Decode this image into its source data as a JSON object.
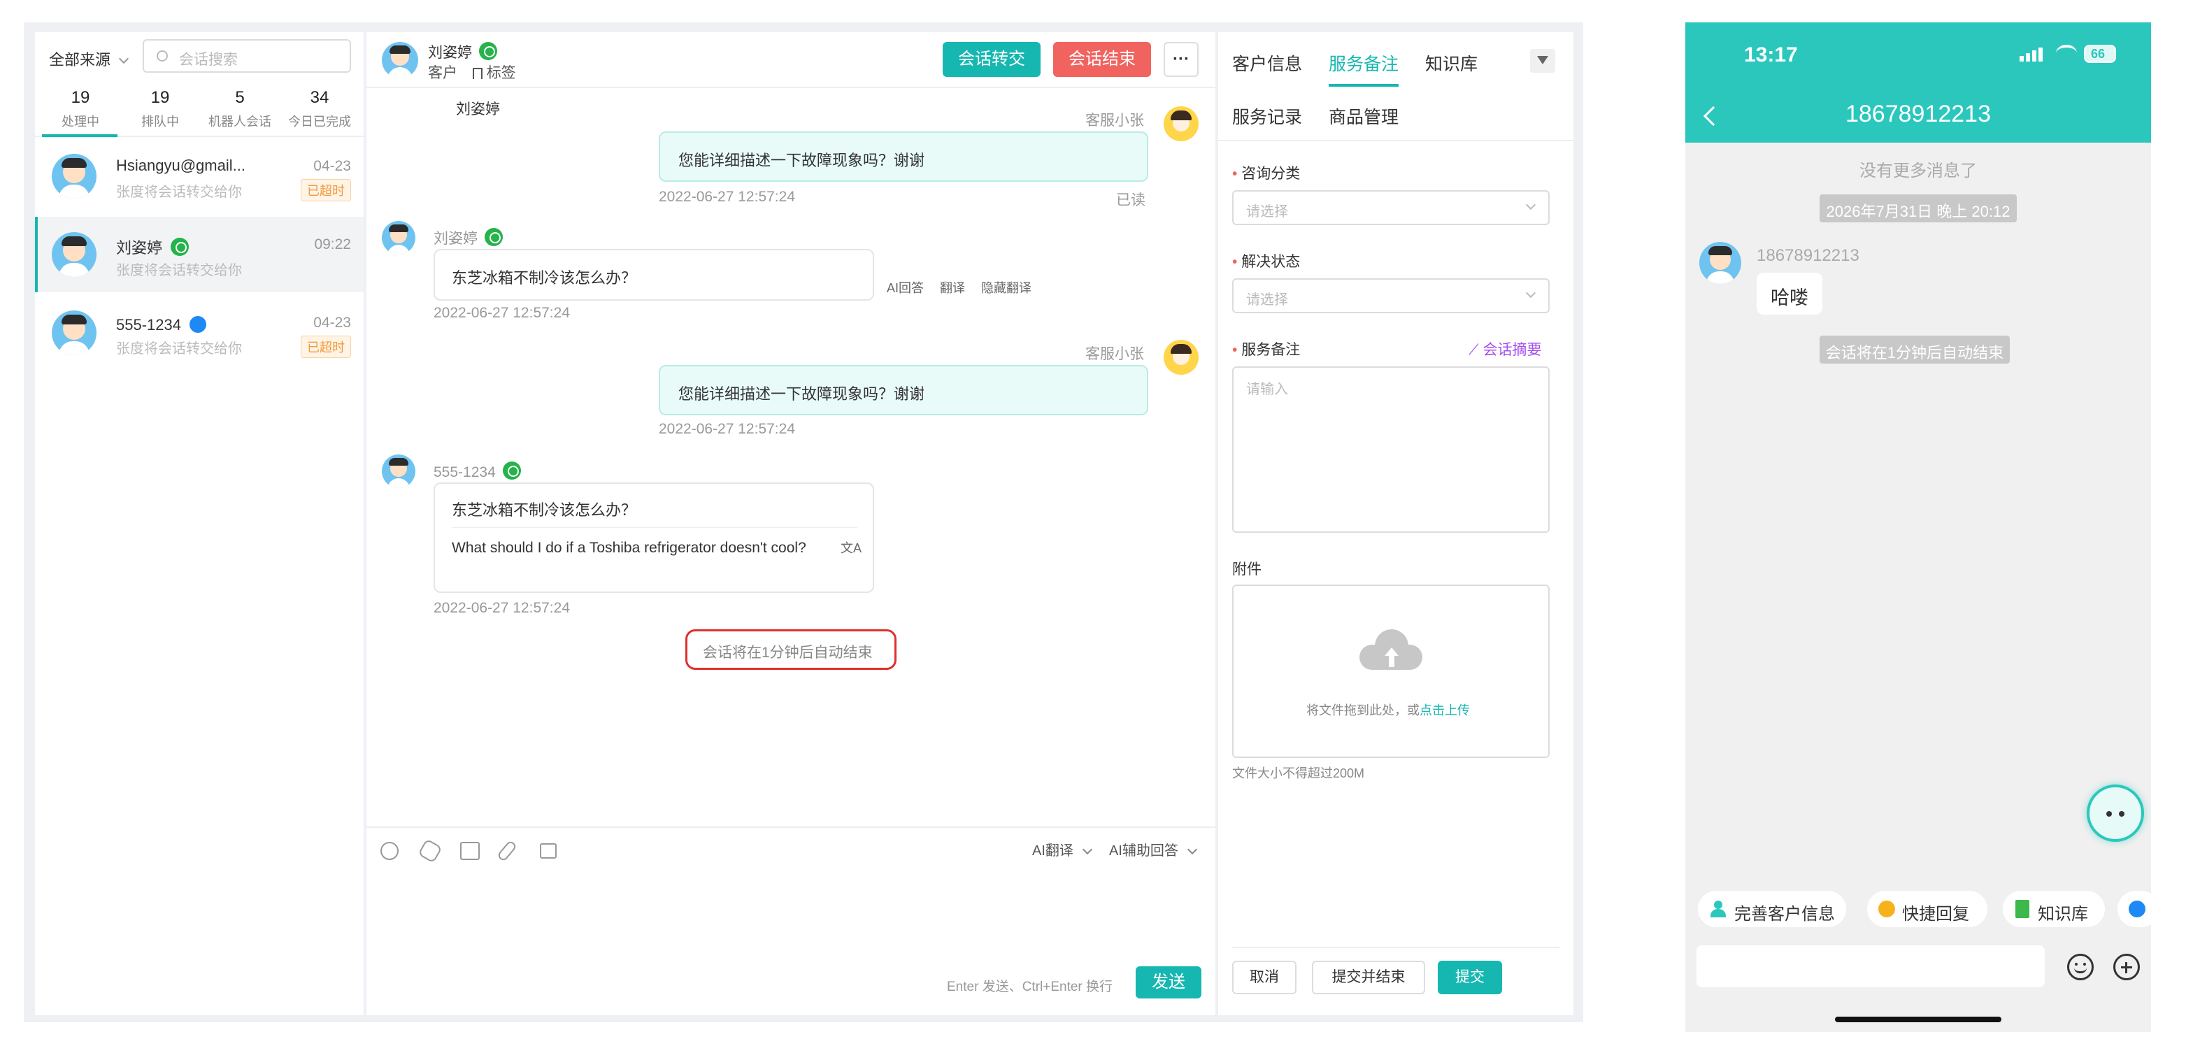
{
  "left": {
    "source_filter": "全部来源",
    "search_placeholder": "会话搜索",
    "stats": [
      {
        "num": "19",
        "label": "处理中"
      },
      {
        "num": "19",
        "label": "排队中"
      },
      {
        "num": "5",
        "label": "机器人会话"
      },
      {
        "num": "34",
        "label": "今日已完成"
      }
    ],
    "conversations": [
      {
        "name": "Hsiangyu@gmail...",
        "preview": "张度将会话转交给你",
        "time": "04-23",
        "badge": "已超时"
      },
      {
        "name": "刘姿婷",
        "preview": "张度将会话转交给你",
        "time": "09:22",
        "badge": ""
      },
      {
        "name": "555-1234",
        "preview": "张度将会话转交给你",
        "time": "04-23",
        "badge": "已超时"
      }
    ]
  },
  "header": {
    "name": "刘姿婷",
    "role": "客户",
    "tag_label": "标签",
    "transfer_button": "会话转交",
    "end_button": "会话结束",
    "more_button": "···"
  },
  "chat": {
    "top_name": "刘姿婷",
    "messages": [
      {
        "sender": "客服小张",
        "text": "您能详细描述一下故障现象吗？谢谢",
        "time": "2022-06-27 12:57:24",
        "status": "已读"
      },
      {
        "sender": "刘姿婷",
        "text": "东芝冰箱不制冷该怎么办？",
        "time": "2022-06-27 12:57:24",
        "actions": [
          "AI回答",
          "翻译",
          "隐藏翻译"
        ]
      },
      {
        "sender": "客服小张",
        "text": "您能详细描述一下故障现象吗？谢谢",
        "time": "2022-06-27 12:57:24"
      },
      {
        "sender": "555-1234",
        "text": "东芝冰箱不制冷该怎么办？",
        "translation": "What should I do if a Toshiba refrigerator doesn't cool?",
        "time": "2022-06-27 12:57:24"
      }
    ],
    "auto_end_notice": "会话将在1分钟后自动结束"
  },
  "composer": {
    "ai_translate": "AI翻译",
    "ai_assist": "AI辅助回答",
    "hint": "Enter 发送、Ctrl+Enter 换行",
    "send_button": "发送"
  },
  "right": {
    "tabs": [
      "客户信息",
      "服务备注",
      "知识库",
      "服务记录",
      "商品管理"
    ],
    "active_tab": "服务备注",
    "category_label": "咨询分类",
    "category_placeholder": "请选择",
    "status_label": "解决状态",
    "status_placeholder": "请选择",
    "note_label": "服务备注",
    "summary_link": "会话摘要",
    "note_placeholder": "请输入",
    "attachment_label": "附件",
    "upload_text": "将文件拖到此处，或",
    "upload_link": "点击上传",
    "size_hint": "文件大小不得超过200M",
    "cancel_button": "取消",
    "submit_end_button": "提交并结束",
    "submit_button": "提交"
  },
  "phone": {
    "time": "13:17",
    "battery": "66",
    "title": "18678912213",
    "no_more": "没有更多消息了",
    "date_chip": "2026年7月31日 晚上 20:12",
    "sender": "18678912213",
    "message": "哈喽",
    "notice": "会话将在1分钟后自动结束",
    "quick_actions": [
      "完善客户信息",
      "快捷回复",
      "知识库"
    ]
  },
  "colors": {
    "teal": "#17b7b1",
    "red_button": "#f0635f",
    "accent": "#2bbcb4",
    "badge_orange": "#f39a3b"
  }
}
